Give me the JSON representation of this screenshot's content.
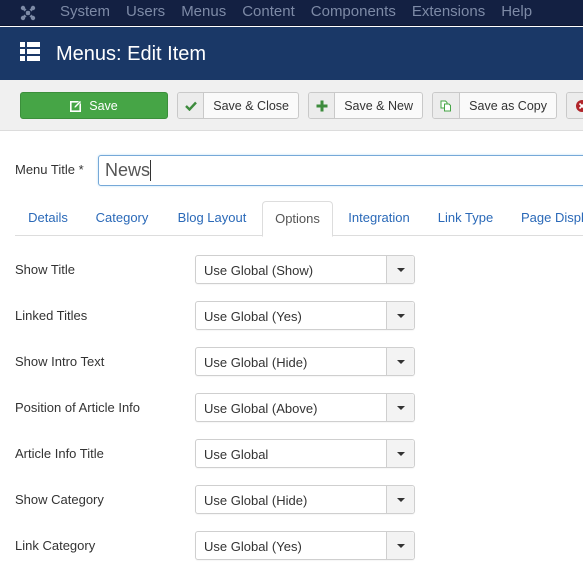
{
  "navbar": {
    "logo_icon": "joomla-logo-icon",
    "menu": [
      "System",
      "Users",
      "Menus",
      "Content",
      "Components",
      "Extensions",
      "Help"
    ]
  },
  "header": {
    "icon": "list-icon",
    "title": "Menus: Edit Item"
  },
  "toolbar": {
    "save": {
      "label": "Save",
      "icon": "edit-icon"
    },
    "save_close": {
      "label": "Save & Close",
      "icon": "checkmark-icon"
    },
    "save_new": {
      "label": "Save & New",
      "icon": "plus-icon"
    },
    "save_copy": {
      "label": "Save as Copy",
      "icon": "copy-icon"
    },
    "close": {
      "icon": "close-circle-icon"
    }
  },
  "colors": {
    "navbar": "#132042",
    "header": "#1a3867",
    "save_green": "#46a546",
    "link_blue": "#2a69b8"
  },
  "form": {
    "menu_title_label": "Menu Title *",
    "menu_title_value": "News"
  },
  "tabs": [
    {
      "label": "Details",
      "active": false
    },
    {
      "label": "Category",
      "active": false
    },
    {
      "label": "Blog Layout",
      "active": false
    },
    {
      "label": "Options",
      "active": true
    },
    {
      "label": "Integration",
      "active": false
    },
    {
      "label": "Link Type",
      "active": false
    },
    {
      "label": "Page Display",
      "active": false
    }
  ],
  "options": [
    {
      "label": "Show Title",
      "value": "Use Global (Show)"
    },
    {
      "label": "Linked Titles",
      "value": "Use Global (Yes)"
    },
    {
      "label": "Show Intro Text",
      "value": "Use Global (Hide)"
    },
    {
      "label": "Position of Article Info",
      "value": "Use Global (Above)"
    },
    {
      "label": "Article Info Title",
      "value": "Use Global"
    },
    {
      "label": "Show Category",
      "value": "Use Global (Hide)"
    },
    {
      "label": "Link Category",
      "value": "Use Global (Yes)"
    }
  ]
}
